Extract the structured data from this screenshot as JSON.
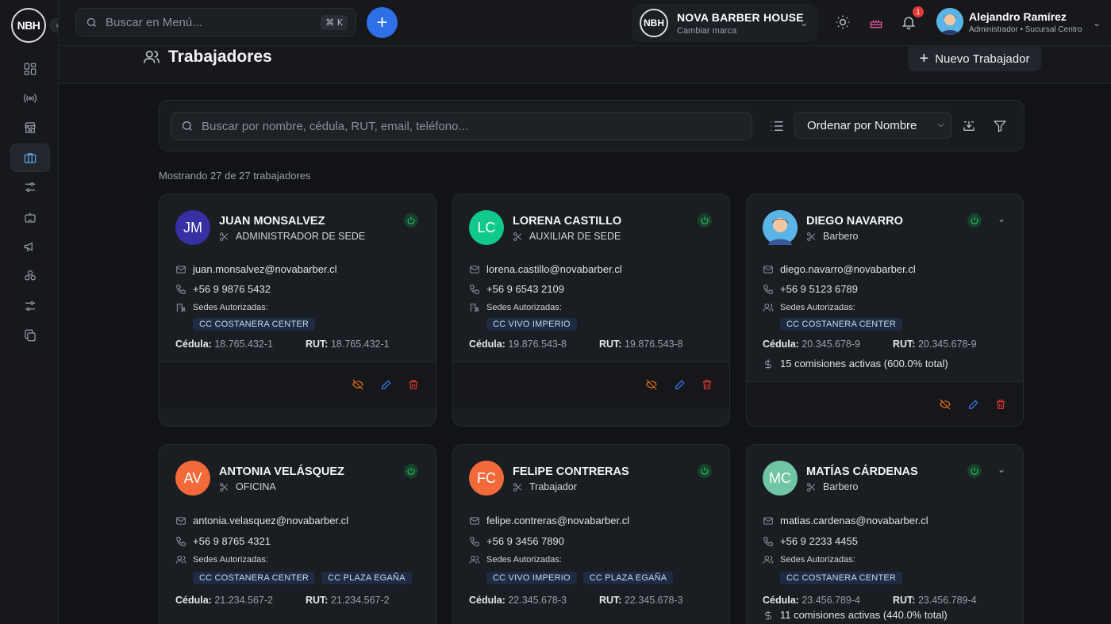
{
  "rail": {
    "logo_text": "NBH",
    "active_index": 3
  },
  "topbar": {
    "search_placeholder": "Buscar en Menú...",
    "search_shortcut": "⌘ K",
    "brand_logo": "NBH",
    "brand_name": "NOVA BARBER HOUSE",
    "brand_sub": "Cambiar marca",
    "notification_count": "1",
    "user_name": "Alejandro Ramírez",
    "user_role": "Administrador  • Sucursal Centro"
  },
  "page": {
    "title": "Trabajadores",
    "new_button": "Nuevo Trabajador",
    "search_placeholder": "Buscar por nombre, cédula, RUT, email, teléfono...",
    "sort_label": "Ordenar por Nombre",
    "showing": "Mostrando 27 de 27 trabajadores"
  },
  "labels": {
    "sedes": "Sedes Autorizadas:",
    "cedula": "Cédula:",
    "rut": "RUT:"
  },
  "colors": {
    "accent": "#2f6fe8",
    "active_green": "#2fcf6f",
    "delete_red": "#e53935",
    "edit_blue": "#3b82f6",
    "deactivate_orange": "#f97316"
  },
  "workers": [
    {
      "initials": "JM",
      "avatar_color": "#3730a3",
      "name": "JUAN MONSALVEZ",
      "role": "ADMINISTRADOR DE SEDE",
      "email": "juan.monsalvez@novabarber.cl",
      "phone": "+56 9 9876 5432",
      "sedes": [
        "CC COSTANERA CENTER"
      ],
      "cedula": "18.765.432-1",
      "rut": "18.765.432-1",
      "commissions": ""
    },
    {
      "initials": "LC",
      "avatar_color": "#10c98a",
      "name": "LORENA CASTILLO",
      "role": "AUXILIAR DE SEDE",
      "email": "lorena.castillo@novabarber.cl",
      "phone": "+56 9 6543 2109",
      "sedes": [
        "CC VIVO IMPERIO"
      ],
      "cedula": "19.876.543-8",
      "rut": "19.876.543-8",
      "commissions": ""
    },
    {
      "initials": "",
      "avatar_color": "#5bb4e6",
      "name": "DIEGO NAVARRO",
      "role": "Barbero",
      "email": "diego.navarro@novabarber.cl",
      "phone": "+56 9 5123 6789",
      "sedes": [
        "CC COSTANERA CENTER"
      ],
      "cedula": "20.345.678-9",
      "rut": "20.345.678-9",
      "commissions": "15 comisiones activas (600.0% total)"
    },
    {
      "initials": "AV",
      "avatar_color": "#f26a3a",
      "name": "ANTONIA VELÁSQUEZ",
      "role": "OFICINA",
      "email": "antonia.velasquez@novabarber.cl",
      "phone": "+56 9 8765 4321",
      "sedes": [
        "CC COSTANERA CENTER",
        "CC PLAZA EGAÑA"
      ],
      "cedula": "21.234.567-2",
      "rut": "21.234.567-2",
      "commissions": ""
    },
    {
      "initials": "FC",
      "avatar_color": "#f26a3a",
      "name": "FELIPE CONTRERAS",
      "role": "Trabajador",
      "email": "felipe.contreras@novabarber.cl",
      "phone": "+56 9 3456 7890",
      "sedes": [
        "CC VIVO IMPERIO",
        "CC PLAZA EGAÑA"
      ],
      "cedula": "22.345.678-3",
      "rut": "22.345.678-3",
      "commissions": ""
    },
    {
      "initials": "MC",
      "avatar_color": "#6fc5a4",
      "name": "MATÍAS CÁRDENAS",
      "role": "Barbero",
      "email": "matias.cardenas@novabarber.cl",
      "phone": "+56 9 2233 4455",
      "sedes": [
        "CC COSTANERA CENTER"
      ],
      "cedula": "23.456.789-4",
      "rut": "23.456.789-4",
      "commissions": "11 comisiones activas (440.0% total)"
    }
  ]
}
